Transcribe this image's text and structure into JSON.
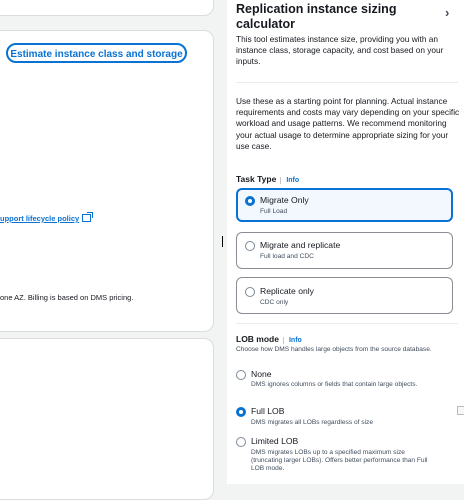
{
  "left": {
    "estimate_button": "Estimate instance class and storage",
    "lifecycle_link": "upport lifecycle policy",
    "az_text": "one AZ. Billing is based on DMS pricing."
  },
  "panel": {
    "title": "Replication instance sizing calculator",
    "intro": "This tool estimates instance size, providing you with an instance class, storage capacity, and cost based on your inputs.",
    "note": "Use these as a starting point for planning. Actual instance requirements and costs may vary depending on your specific workload and usage patterns. We recommend monitoring your actual usage to determine appropriate sizing for your use case.",
    "task_type": {
      "label": "Task Type",
      "info": "Info",
      "options": [
        {
          "title": "Migrate Only",
          "desc": "Full Load",
          "selected": true
        },
        {
          "title": "Migrate and replicate",
          "desc": "Full load and CDC",
          "selected": false
        },
        {
          "title": "Replicate only",
          "desc": "CDC only",
          "selected": false
        }
      ]
    },
    "lob_mode": {
      "label": "LOB mode",
      "info": "Info",
      "description": "Choose how DMS handles large objects from the source database.",
      "options": [
        {
          "title": "None",
          "desc": "DMS ignores columns or fields that contain large objects.",
          "selected": false
        },
        {
          "title": "Full LOB",
          "desc": "DMS migrates all LOBs regardless of size",
          "selected": true
        },
        {
          "title": "Limited LOB",
          "desc": "DMS migrates LOBs up to a specified maximum size (truncating larger LOBs). Offers better performance than Full LOB mode.",
          "selected": false
        }
      ]
    }
  },
  "colors": {
    "accent": "#0972d3",
    "selected_bg": "#f2f8fd"
  },
  "icons": {
    "close": "chevron-right-icon",
    "external": "external-link-icon"
  }
}
